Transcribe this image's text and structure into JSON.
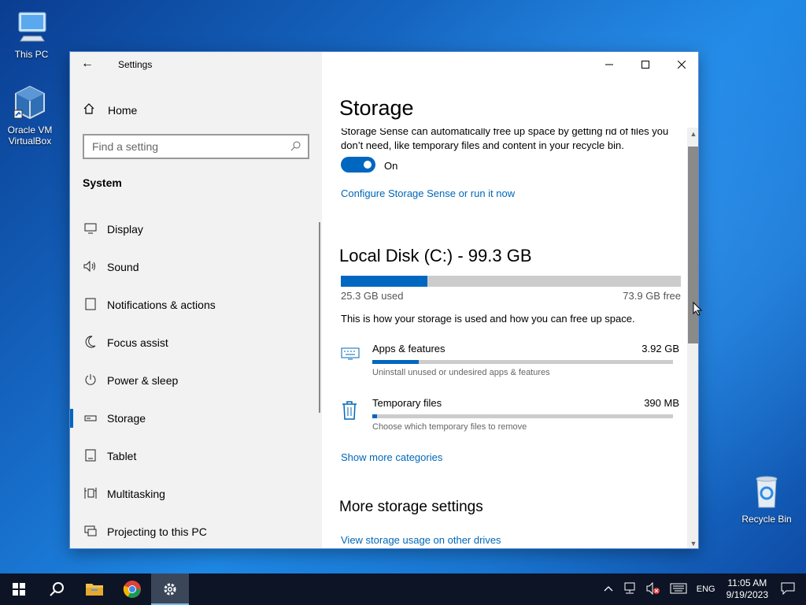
{
  "desktop": {
    "icons": [
      {
        "label": "This PC"
      },
      {
        "label": "Oracle VM VirtualBox"
      },
      {
        "label": "Recycle Bin"
      }
    ]
  },
  "window": {
    "title": "Settings",
    "nav": {
      "home_label": "Home",
      "search_placeholder": "Find a setting",
      "section_title": "System",
      "items": [
        {
          "label": "Display",
          "icon": "display-icon"
        },
        {
          "label": "Sound",
          "icon": "speaker-icon"
        },
        {
          "label": "Notifications & actions",
          "icon": "notification-icon"
        },
        {
          "label": "Focus assist",
          "icon": "moon-icon"
        },
        {
          "label": "Power & sleep",
          "icon": "power-icon"
        },
        {
          "label": "Storage",
          "icon": "storage-drive-icon",
          "active": true
        },
        {
          "label": "Tablet",
          "icon": "tablet-icon"
        },
        {
          "label": "Multitasking",
          "icon": "multitasking-icon"
        },
        {
          "label": "Projecting to this PC",
          "icon": "projecting-icon"
        }
      ]
    },
    "content": {
      "page_title": "Storage",
      "storage_sense_desc": "Storage Sense can automatically free up space by getting rid of files you don’t need, like temporary files and content in your recycle bin.",
      "toggle_state": "On",
      "configure_link": "Configure Storage Sense or run it now",
      "disk": {
        "title": "Local Disk (C:) - 99.3 GB",
        "used_label": "25.3 GB used",
        "free_label": "73.9 GB free",
        "used_fraction": 0.255
      },
      "usage_desc": "This is how your storage is used and how you can free up space.",
      "categories": [
        {
          "name": "Apps & features",
          "size": "3.92 GB",
          "sub": "Uninstall unused or undesired apps & features",
          "fraction": 0.155,
          "icon": "keyboard-icon"
        },
        {
          "name": "Temporary files",
          "size": "390 MB",
          "sub": "Choose which temporary files to remove",
          "fraction": 0.015,
          "icon": "trash-icon"
        }
      ],
      "show_more_link": "Show more categories",
      "more_settings_title": "More storage settings",
      "other_drives_link": "View storage usage on other drives"
    }
  },
  "taskbar": {
    "language": "ENG",
    "time": "11:05 AM",
    "date": "9/19/2023"
  },
  "colors": {
    "accent": "#0067c0",
    "link": "#0067b8",
    "taskbar": "#0c1425"
  }
}
